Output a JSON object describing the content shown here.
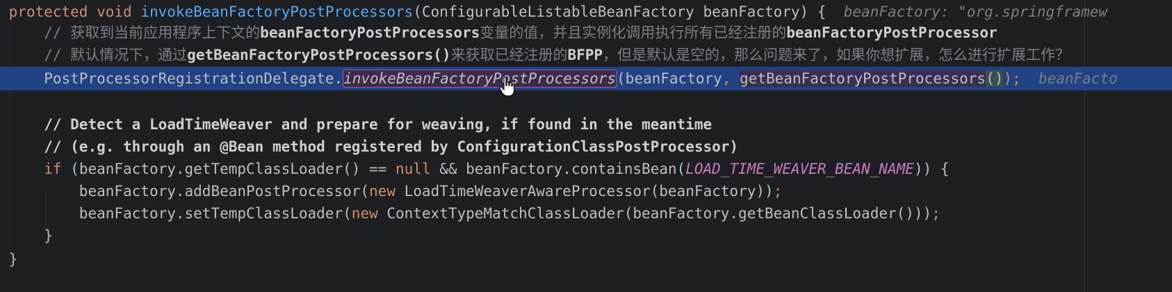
{
  "editor": {
    "lines": [
      {
        "id": "line-1",
        "segments": [
          {
            "text": "protected void ",
            "style": "kw"
          },
          {
            "text": "invokeBeanFactoryPostProcessors",
            "style": "fn"
          },
          {
            "text": "(ConfigurableListableBeanFactory beanFactory) {  ",
            "style": "plain"
          },
          {
            "text": "beanFactory: \"org.springframew",
            "style": "hint"
          }
        ]
      },
      {
        "id": "line-2",
        "segments": [
          {
            "text": "    // 获取到当前应用程序上下文的",
            "style": "cm"
          },
          {
            "text": "beanFactoryPostProcessors",
            "style": "cm-bold"
          },
          {
            "text": "变量的值，并且实例化调用执行所有已经注册的",
            "style": "cm"
          },
          {
            "text": "beanFactoryPostProcessor",
            "style": "cm-bold"
          }
        ]
      },
      {
        "id": "line-3",
        "segments": [
          {
            "text": "    // 默认情况下，通过",
            "style": "cm"
          },
          {
            "text": "getBeanFactoryPostProcessors()",
            "style": "cm-bold"
          },
          {
            "text": "来获取已经注册的",
            "style": "cm"
          },
          {
            "text": "BFPP",
            "style": "cm-bold"
          },
          {
            "text": "，但是默认是空的，那么问题来了，如果你想扩展，怎么进行扩展工作？",
            "style": "cm"
          }
        ]
      },
      {
        "id": "line-4",
        "segments": [
          {
            "text": "    PostProcessorRegistrationDelegate.",
            "style": "plain"
          },
          {
            "text": "invokeBeanFactoryPostProcessors",
            "style": "italic-fn-box"
          },
          {
            "text": "(beanFactory",
            "style": "plain"
          },
          {
            "text": ", ",
            "style": "comma"
          },
          {
            "text": "getBeanFactoryPostProcessors",
            "style": "arg-box"
          },
          {
            "text": "()",
            "style": "paren"
          },
          {
            "text": ");  ",
            "style": "comma"
          },
          {
            "text": "beanFacto",
            "style": "hint"
          }
        ]
      },
      {
        "id": "line-5",
        "segments": []
      },
      {
        "id": "line-6",
        "segments": [
          {
            "text": "    // Detect a LoadTimeWeaver and prepare for weaving, if found in the meantime",
            "style": "cm-bold"
          }
        ]
      },
      {
        "id": "line-7",
        "segments": [
          {
            "text": "    // (e.g. through an @Bean method registered by ConfigurationClassPostProcessor)",
            "style": "cm-bold"
          }
        ]
      },
      {
        "id": "line-8",
        "segments": [
          {
            "text": "    ",
            "style": "plain"
          },
          {
            "text": "if",
            "style": "kw"
          },
          {
            "text": " (beanFactory.getTempClassLoader() == ",
            "style": "plain"
          },
          {
            "text": "null",
            "style": "kw"
          },
          {
            "text": " && beanFactory.containsBean(",
            "style": "plain"
          },
          {
            "text": "LOAD_TIME_WEAVER_BEAN_NAME",
            "style": "const"
          },
          {
            "text": ")) {",
            "style": "plain"
          }
        ]
      },
      {
        "id": "line-9",
        "segments": [
          {
            "text": "        beanFactory.addBeanPostProcessor(",
            "style": "plain"
          },
          {
            "text": "new",
            "style": "kw"
          },
          {
            "text": " LoadTimeWeaverAwareProcessor(beanFactory))",
            "style": "plain"
          },
          {
            "text": ";",
            "style": "kw"
          }
        ]
      },
      {
        "id": "line-10",
        "segments": [
          {
            "text": "        beanFactory.setTempClassLoader(",
            "style": "plain"
          },
          {
            "text": "new",
            "style": "kw"
          },
          {
            "text": " ContextTypeMatchClassLoader(beanFactory.getBeanClassLoader()))",
            "style": "plain"
          },
          {
            "text": ";",
            "style": "kw"
          }
        ]
      },
      {
        "id": "line-11",
        "segments": [
          {
            "text": "    }",
            "style": "plain"
          }
        ]
      },
      {
        "id": "line-12",
        "segments": [
          {
            "text": "}",
            "style": "plain"
          }
        ]
      }
    ],
    "selected_line": "line-4",
    "colors": {
      "background": "#1e1f22",
      "selection": "#214283",
      "keyword": "#cf8e6d",
      "method": "#56a8f5",
      "comment": "#7a7e85",
      "constant": "#c77dbb"
    }
  }
}
